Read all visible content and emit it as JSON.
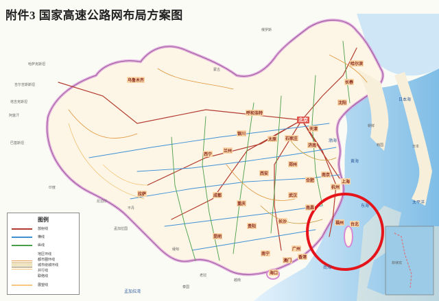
{
  "title": "附件3 国家高速公路网布局方案图",
  "legend": {
    "title": "图例",
    "items": [
      {
        "label": "放射线",
        "color": "#b33a2e"
      },
      {
        "label": "横线",
        "color": "#3d8fd8"
      },
      {
        "label": "纵线",
        "color": "#4a9e45"
      },
      {
        "labels": [
          "地区环线",
          "都市圈环线",
          "城市绕城环线",
          "并行线",
          "联络线"
        ],
        "colors": [
          "#e0943a",
          "#c99a3a",
          "#d9b84a",
          "#8a6f3a",
          "#f0c070"
        ]
      },
      {
        "label": "展望线",
        "color": "#f5c77a"
      }
    ]
  },
  "cities": [
    {
      "name": "北京",
      "style": "cap"
    },
    {
      "name": "乌鲁木齐",
      "style": "prov"
    },
    {
      "name": "呼和浩特",
      "style": "prov"
    },
    {
      "name": "银川",
      "style": "prov"
    },
    {
      "name": "兰州",
      "style": "prov"
    },
    {
      "name": "西宁",
      "style": "prov"
    },
    {
      "name": "拉萨",
      "style": "prov"
    },
    {
      "name": "成都",
      "style": "prov"
    },
    {
      "name": "重庆",
      "style": "prov"
    },
    {
      "name": "贵阳",
      "style": "prov"
    },
    {
      "name": "昆明",
      "style": "prov"
    },
    {
      "name": "南宁",
      "style": "prov"
    },
    {
      "name": "海口",
      "style": "prov"
    },
    {
      "name": "广州",
      "style": "prov"
    },
    {
      "name": "长沙",
      "style": "prov"
    },
    {
      "name": "武汉",
      "style": "prov"
    },
    {
      "name": "南昌",
      "style": "prov"
    },
    {
      "name": "福州",
      "style": "prov"
    },
    {
      "name": "杭州",
      "style": "prov"
    },
    {
      "name": "上海",
      "style": "prov"
    },
    {
      "name": "南京",
      "style": "prov"
    },
    {
      "name": "合肥",
      "style": "prov"
    },
    {
      "name": "郑州",
      "style": "prov"
    },
    {
      "name": "济南",
      "style": "prov"
    },
    {
      "name": "石家庄",
      "style": "prov"
    },
    {
      "name": "太原",
      "style": "prov"
    },
    {
      "name": "西安",
      "style": "prov"
    },
    {
      "name": "天津",
      "style": "prov"
    },
    {
      "name": "沈阳",
      "style": "prov"
    },
    {
      "name": "长春",
      "style": "prov"
    },
    {
      "name": "哈尔滨",
      "style": "prov"
    },
    {
      "name": "台北",
      "style": "prov"
    },
    {
      "name": "澳门",
      "style": "prov"
    },
    {
      "name": "香港",
      "style": "prov"
    }
  ],
  "countries": [
    "蒙古",
    "俄罗斯",
    "哈萨克斯坦",
    "吉尔吉斯斯坦",
    "塔吉克斯坦",
    "阿富汗",
    "巴基斯坦",
    "印度",
    "尼泊尔",
    "不丹",
    "孟加拉国",
    "缅甸",
    "老挝",
    "越南",
    "泰国",
    "朝鲜",
    "韩国",
    "日本",
    "菲律宾"
  ],
  "water": [
    "渤海",
    "黄海",
    "东海",
    "南海",
    "日本海",
    "太平洋",
    "孟加拉湾"
  ],
  "colors": {
    "highlight": "#e5141b",
    "border": "#d68ad6",
    "sea": "#a9d3ee",
    "land": "#fdf6e6"
  }
}
